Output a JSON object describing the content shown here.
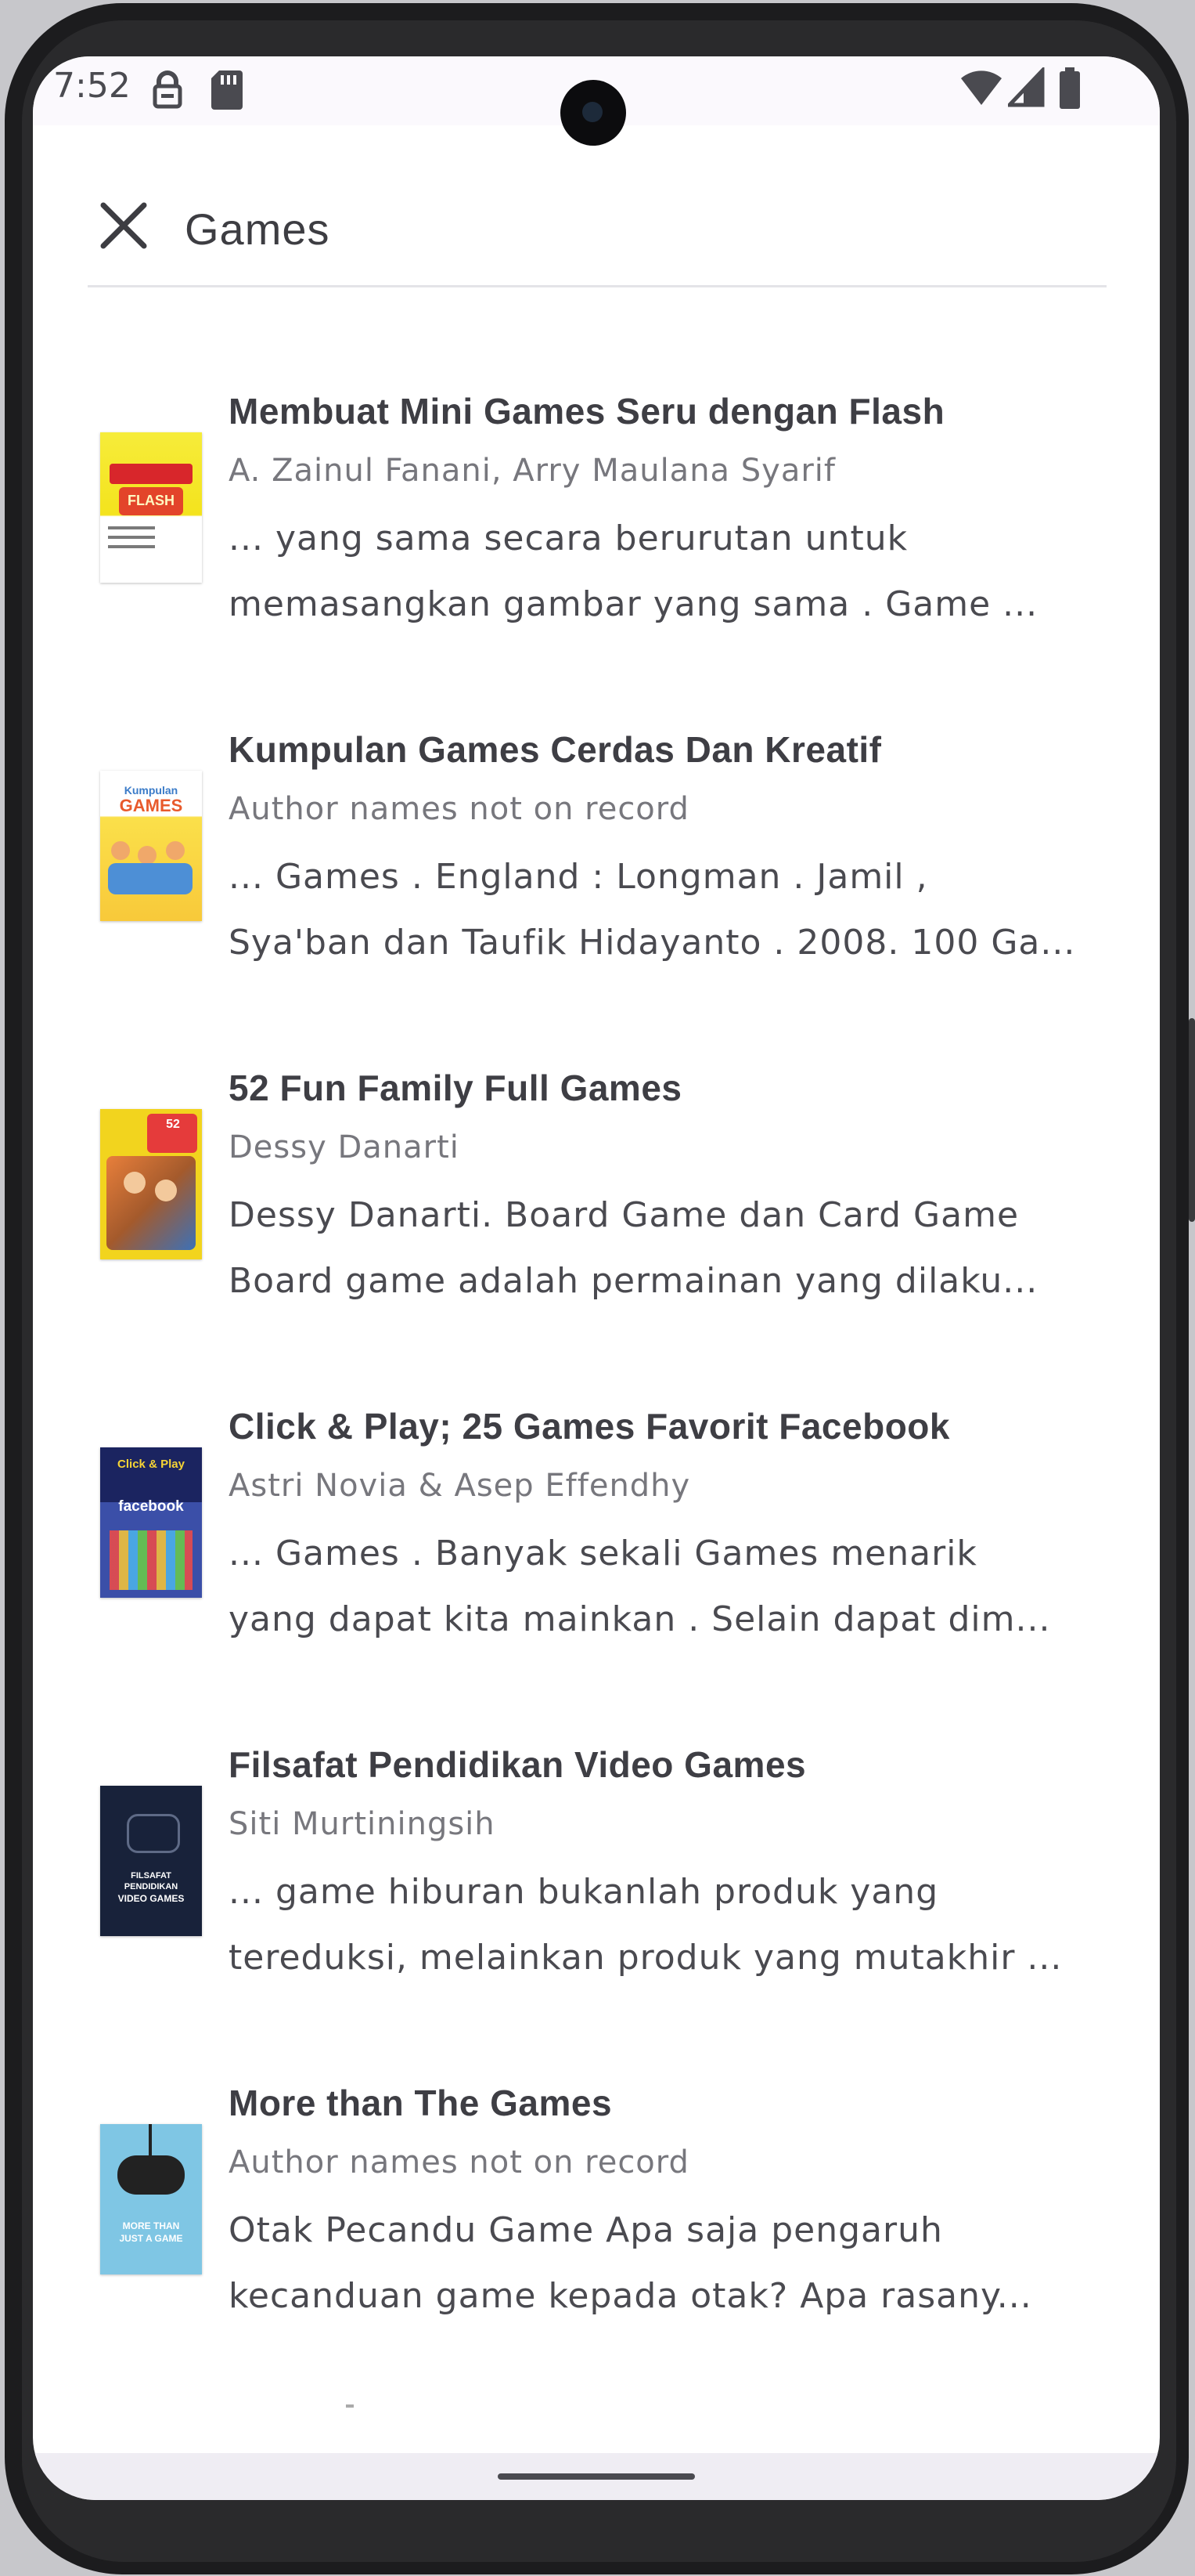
{
  "status_bar": {
    "time": "7:52",
    "left_icons": [
      "vpn-key-icon",
      "sd-card-icon"
    ],
    "right_icons": [
      "wifi-icon",
      "cellular-signal-icon",
      "battery-icon"
    ]
  },
  "app_bar": {
    "close_icon": "close-icon",
    "title": "Games"
  },
  "books": [
    {
      "title": "Membuat Mini Games Seru dengan Flash",
      "author": "A. Zainul Fanani, Arry Maulana Syarif",
      "snippet_line1": "... yang sama secara berurutan untuk",
      "snippet_line2": "memasangkan gambar yang sama . Game ...",
      "cover_text": "MINI GAMES SERU FLASH",
      "cover_color": "#f4e31d"
    },
    {
      "title": "Kumpulan Games Cerdas Dan Kreatif",
      "author": "Author names not on record",
      "snippet_line1": "... Games . England : Longman . Jamil ,",
      "snippet_line2": "Sya'ban dan Taufik Hidayanto . 2008. 100 Ga...",
      "cover_text": "Kumpulan GAMES Cerdas & Kreatif",
      "cover_color": "#fbe04a"
    },
    {
      "title": "52 Fun Family Full Games",
      "author": "Dessy Danarti",
      "snippet_line1": "Dessy Danarti. Board Game dan Card Game",
      "snippet_line2": "Board game adalah permainan yang dilaku...",
      "cover_text": "52 Fun Family Full Games",
      "cover_color": "#f2d41e"
    },
    {
      "title": "Click & Play; 25 Games Favorit Facebook",
      "author": "Astri Novia & Asep Effendhy",
      "snippet_line1": "... Games . Banyak sekali Games menarik",
      "snippet_line2": "yang dapat kita mainkan . Selain dapat dim...",
      "cover_text": "Click & Play facebook",
      "cover_color": "#3b4fa8"
    },
    {
      "title": "Filsafat Pendidikan Video Games",
      "author": " Siti Murtiningsih",
      "snippet_line1": "... game hiburan bukanlah produk yang",
      "snippet_line2": "tereduksi, melainkan produk yang mutakhir ...",
      "cover_text": "FILSAFAT PENDIDIKAN VIDEO GAMES",
      "cover_color": "#18223a"
    },
    {
      "title": "More than The Games",
      "author": "Author names not on record",
      "snippet_line1": "Otak Pecandu Game Apa saja pengaruh",
      "snippet_line2": "kecanduan game kepada otak? Apa rasany...",
      "cover_text": "MORE THAN JUST A GAME",
      "cover_color": "#7fc6e4"
    }
  ]
}
